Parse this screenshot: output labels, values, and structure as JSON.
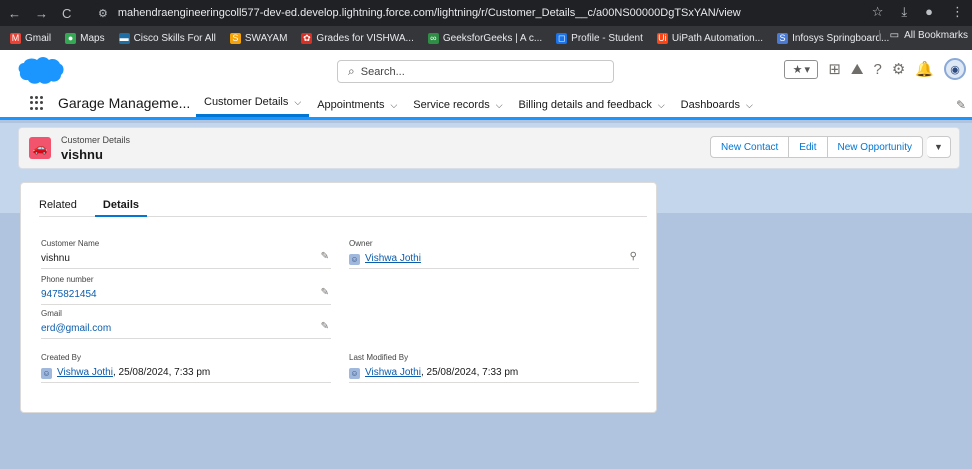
{
  "browser": {
    "nav_back": "←",
    "nav_forward": "→",
    "nav_reload": "C",
    "url": "mahendraengineeringcoll577-dev-ed.develop.lightning.force.com/lightning/r/Customer_Details__c/a00NS00000DgTSxYAN/view",
    "bookmarks": [
      {
        "label": "Gmail",
        "color": "#ea4335",
        "glyph": "M"
      },
      {
        "label": "Maps",
        "color": "#34a853",
        "glyph": "●"
      },
      {
        "label": "Cisco Skills For All",
        "color": "#1d6fa5",
        "glyph": "▬"
      },
      {
        "label": "SWAYAM",
        "color": "#f4a30a",
        "glyph": "S"
      },
      {
        "label": "Grades for VISHWA...",
        "color": "#d93025",
        "glyph": "✿"
      },
      {
        "label": "GeeksforGeeks | A c...",
        "color": "#2f8d46",
        "glyph": "∞"
      },
      {
        "label": "Profile - Student",
        "color": "#1a73e8",
        "glyph": "◻"
      },
      {
        "label": "UiPath Automation...",
        "color": "#fa4616",
        "glyph": "Ui"
      },
      {
        "label": "Infosys Springboard...",
        "color": "#4a7bd4",
        "glyph": "S"
      }
    ],
    "all_bookmarks": "All Bookmarks"
  },
  "sf": {
    "search_placeholder": "Search...",
    "app_name": "Garage Manageme...",
    "nav": [
      {
        "label": "Customer Details",
        "active": true
      },
      {
        "label": "Appointments",
        "active": false
      },
      {
        "label": "Service records",
        "active": false
      },
      {
        "label": "Billing details and feedback",
        "active": false
      },
      {
        "label": "Dashboards",
        "active": false
      }
    ]
  },
  "record": {
    "object_type": "Customer Details",
    "name": "vishnu",
    "actions": [
      "New Contact",
      "Edit",
      "New Opportunity"
    ]
  },
  "tabs": [
    "Related",
    "Details"
  ],
  "fields": {
    "customer_name_label": "Customer Name",
    "customer_name": "vishnu",
    "phone_label": "Phone number",
    "phone": "9475821454",
    "gmail_label": "Gmail",
    "gmail": "erd@gmail.com",
    "owner_label": "Owner",
    "owner": "Vishwa Jothi",
    "created_label": "Created By",
    "created_user": "Vishwa Jothi",
    "created_date": ", 25/08/2024, 7:33 pm",
    "modified_label": "Last Modified By",
    "modified_user": "Vishwa Jothi",
    "modified_date": ", 25/08/2024, 7:33 pm"
  },
  "colors": {
    "brand_blue": "#0176d3",
    "record_icon": "#f2536d",
    "page_bg": "#b0c4df"
  }
}
